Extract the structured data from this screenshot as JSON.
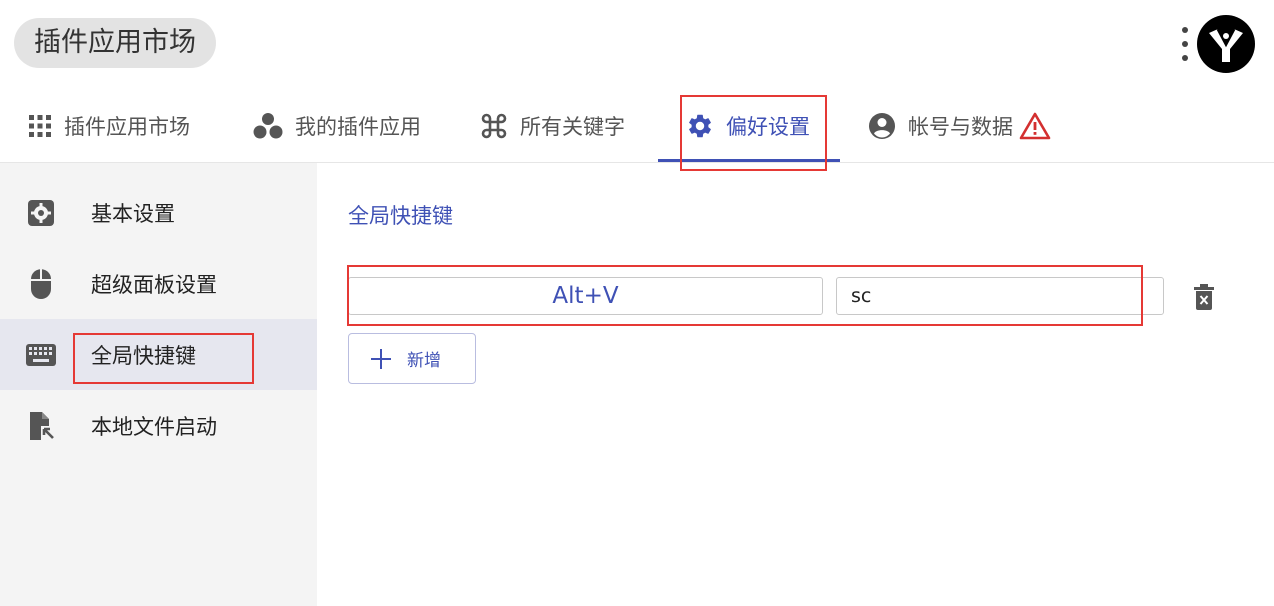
{
  "app": {
    "title": "插件应用市场"
  },
  "tabs": [
    {
      "label": "插件应用市场",
      "icon": "grid-apps-icon"
    },
    {
      "label": "我的插件应用",
      "icon": "bubbles-icon"
    },
    {
      "label": "所有关键字",
      "icon": "command-key-icon"
    },
    {
      "label": "偏好设置",
      "icon": "gear-icon",
      "active": true
    },
    {
      "label": "帐号与数据",
      "icon": "account-circle-icon",
      "badge_icon": "warning-icon"
    }
  ],
  "sidebar": {
    "items": [
      {
        "label": "基本设置",
        "icon": "settings-box-icon"
      },
      {
        "label": "超级面板设置",
        "icon": "mouse-icon"
      },
      {
        "label": "全局快捷键",
        "icon": "keyboard-icon",
        "active": true
      },
      {
        "label": "本地文件启动",
        "icon": "file-launch-icon"
      }
    ]
  },
  "main": {
    "section_title": "全局快捷键",
    "shortcuts": [
      {
        "key": "Alt+V",
        "command": "sc"
      }
    ],
    "add_label": "新增"
  },
  "colors": {
    "accent": "#3f51b5",
    "annotation": "#e53935",
    "warning": "#d32f2f"
  }
}
